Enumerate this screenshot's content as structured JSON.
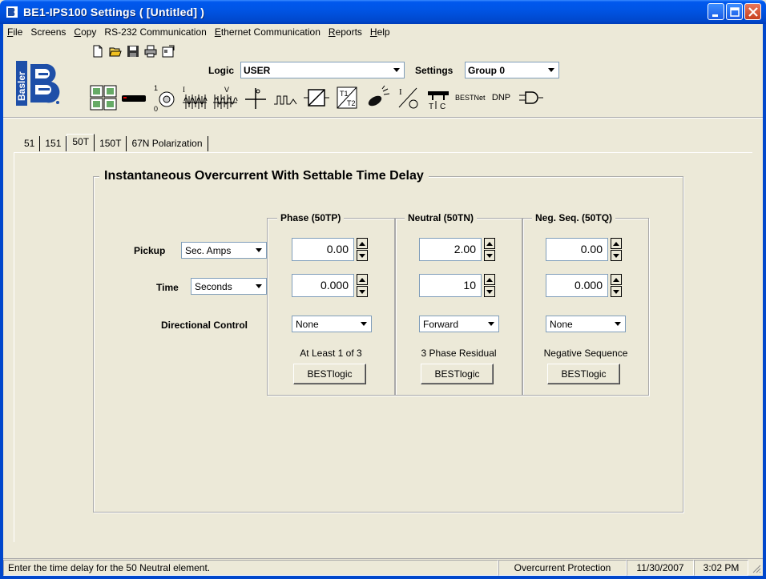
{
  "window": {
    "title": "BE1-IPS100 Settings   ( [Untitled] )"
  },
  "menu": {
    "items": [
      {
        "label": "File",
        "u": "F",
        "rest": "ile"
      },
      {
        "label": "Screens",
        "u": "",
        "rest": "Screens"
      },
      {
        "label": "Copy",
        "u": "C",
        "rest": "opy"
      },
      {
        "label": "RS-232 Communication",
        "u": "",
        "rest": "RS-232 Communication"
      },
      {
        "label": "Ethernet Communication",
        "u": "E",
        "rest": "thernet Communication"
      },
      {
        "label": "Reports",
        "u": "R",
        "rest": "eports"
      },
      {
        "label": "Help",
        "u": "H",
        "rest": "elp"
      }
    ]
  },
  "toolbar": {
    "logic_label": "Logic",
    "logic_value": "USER",
    "settings_label": "Settings",
    "settings_value": "Group 0",
    "bestnet_label": "BESTNet",
    "dnp_label": "DNP",
    "logo_text": "Basler"
  },
  "tabs": [
    {
      "label": "51",
      "active": false
    },
    {
      "label": "151",
      "active": false
    },
    {
      "label": "50T",
      "active": true
    },
    {
      "label": "150T",
      "active": false
    },
    {
      "label": "67N Polarization",
      "active": false
    }
  ],
  "panel": {
    "title": "Instantaneous Overcurrent With Settable Time Delay",
    "pickup_label": "Pickup",
    "pickup_unit": "Sec. Amps",
    "time_label": "Time",
    "time_unit": "Seconds",
    "directional_label": "Directional Control",
    "columns": [
      {
        "title": "Phase (50TP)",
        "pickup": "0.00",
        "time": "0.000",
        "directional": "None",
        "caption": "At Least 1 of 3",
        "button": "BESTlogic"
      },
      {
        "title": "Neutral (50TN)",
        "pickup": "2.00",
        "time": "10",
        "directional": "Forward",
        "caption": "3 Phase Residual",
        "button": "BESTlogic"
      },
      {
        "title": "Neg. Seq. (50TQ)",
        "pickup": "0.00",
        "time": "0.000",
        "directional": "None",
        "caption": "Negative Sequence",
        "button": "BESTlogic"
      }
    ]
  },
  "status": {
    "message": "Enter the time delay for the 50 Neutral element.",
    "section": "Overcurrent Protection",
    "date": "11/30/2007",
    "time": "3:02 PM"
  },
  "colors": {
    "titlebar": "#0055E5",
    "dialog_bg": "#ECE9D8",
    "logo_blue": "#1E4FA8"
  }
}
